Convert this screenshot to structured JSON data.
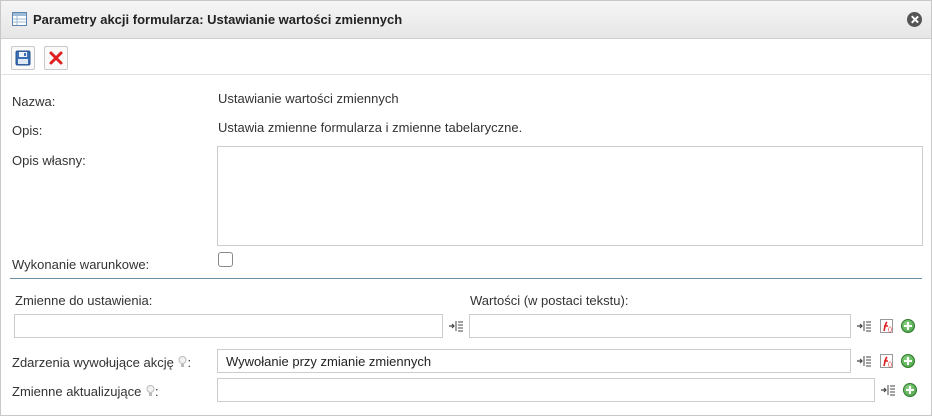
{
  "dialog": {
    "title": "Parametry akcji formularza: Ustawianie wartości zmiennych",
    "title_icon": "table-form-icon",
    "close_icon": "close-circle-icon"
  },
  "toolbar": {
    "save_icon": "save-disk-icon",
    "cancel_icon": "red-x-icon"
  },
  "form": {
    "name_label": "Nazwa:",
    "name_value": "Ustawianie wartości zmiennych",
    "desc_label": "Opis:",
    "desc_value": "Ustawia zmienne formularza i zmienne tabelaryczne.",
    "custom_desc_label": "Opis własny:",
    "custom_desc_value": "",
    "conditional_label": "Wykonanie warunkowe:",
    "conditional_checked": false,
    "vars_to_set_label": "Zmienne do ustawienia:",
    "vars_to_set_value": "",
    "values_label": "Wartości (w postaci tekstu):",
    "values_value": "",
    "events_label": "Zdarzenia wywołujące akcję",
    "events_suffix": ":",
    "events_value": "Wywołanie przy zmianie zmiennych",
    "updating_vars_label": "Zmienne aktualizujące",
    "updating_vars_suffix": ":",
    "updating_vars_value": ""
  },
  "icons": {
    "insert_variable": "insert-variable-icon",
    "function": "function-icon",
    "add": "add-green-icon",
    "hint": "lightbulb-hint-icon"
  }
}
